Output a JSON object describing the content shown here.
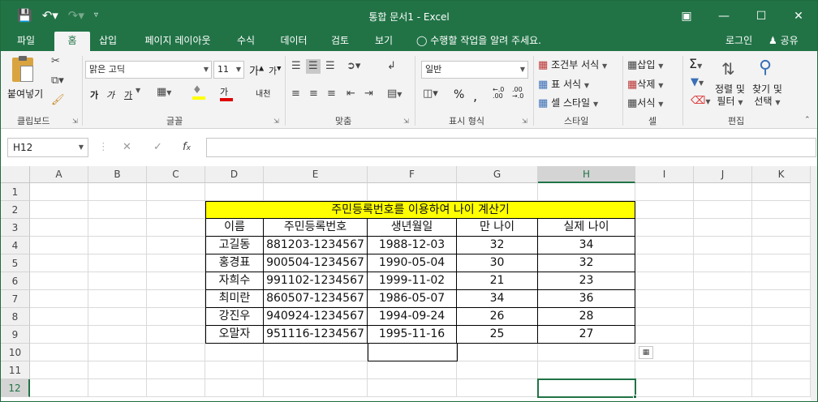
{
  "window": {
    "title": "통합 문서1 - Excel"
  },
  "tabs": [
    "파일",
    "홈",
    "삽입",
    "페이지 레이아웃",
    "수식",
    "데이터",
    "검토",
    "보기"
  ],
  "tell_me": "수행할 작업을 알려 주세요.",
  "account": {
    "login": "로그인",
    "share": "공유"
  },
  "ribbon": {
    "clipboard": {
      "paste": "붙여넣기",
      "label": "클립보드"
    },
    "font": {
      "name": "맑은 고딕",
      "size": "11",
      "grow": "가",
      "shrink": "가",
      "bold": "가",
      "italic": "가",
      "underline": "가",
      "font_color": "가",
      "phonetic": "내천",
      "label": "글꼴"
    },
    "alignment": {
      "label": "맞춤"
    },
    "number": {
      "format": "일반",
      "label": "표시 형식"
    },
    "styles": {
      "conditional": "조건부 서식",
      "table": "표 서식",
      "cell": "셀 스타일",
      "label": "스타일"
    },
    "cells": {
      "insert": "삽입",
      "delete": "삭제",
      "format": "서식",
      "label": "셀"
    },
    "editing": {
      "sort": "정렬 및",
      "sort2": "필터",
      "find": "찾기 및",
      "find2": "선택",
      "label": "편집"
    }
  },
  "formula_bar": {
    "name_box": "H12",
    "formula": ""
  },
  "columns": [
    "A",
    "B",
    "C",
    "D",
    "E",
    "F",
    "G",
    "H",
    "I",
    "J",
    "K"
  ],
  "rows": [
    "1",
    "2",
    "3",
    "4",
    "5",
    "6",
    "7",
    "8",
    "9",
    "10",
    "11",
    "12"
  ],
  "sheet": {
    "title": "주민등록번호를 이용하여 나이 계산기",
    "headers": [
      "이름",
      "주민등록번호",
      "생년월일",
      "만 나이",
      "실제 나이"
    ],
    "records": [
      [
        "고길동",
        "881203-1234567",
        "1988-12-03",
        "32",
        "34"
      ],
      [
        "홍경표",
        "900504-1234567",
        "1990-05-04",
        "30",
        "32"
      ],
      [
        "자희수",
        "991102-1234567",
        "1999-11-02",
        "21",
        "23"
      ],
      [
        "최미란",
        "860507-1234567",
        "1986-05-07",
        "34",
        "36"
      ],
      [
        "강진우",
        "940924-1234567",
        "1994-09-24",
        "26",
        "28"
      ],
      [
        "오말자",
        "951116-1234567",
        "1995-11-16",
        "25",
        "27"
      ]
    ]
  },
  "colors": {
    "excel_green": "#217346",
    "title_fill": "#ffff00"
  }
}
